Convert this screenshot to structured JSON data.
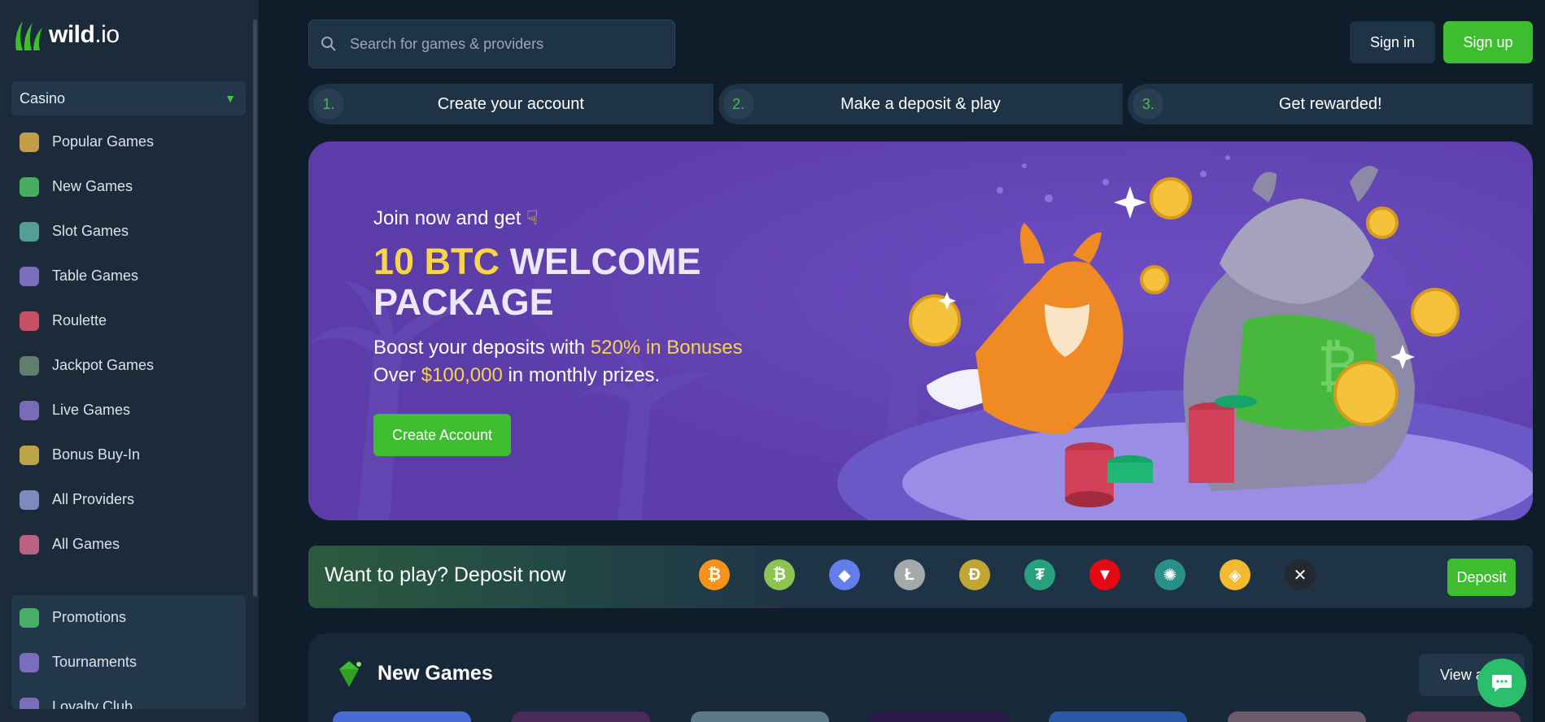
{
  "brand": {
    "name": "wild",
    "suffix": ".io"
  },
  "sidebar": {
    "category": "Casino",
    "items": [
      {
        "label": "Popular Games",
        "icon": "popular-games-icon",
        "color": "#e0b24a"
      },
      {
        "label": "New Games",
        "icon": "new-games-icon",
        "color": "#4fc36a"
      },
      {
        "label": "Slot Games",
        "icon": "slot-games-icon",
        "color": "#5fb3a4"
      },
      {
        "label": "Table Games",
        "icon": "table-games-icon",
        "color": "#8d7bd6"
      },
      {
        "label": "Roulette",
        "icon": "roulette-icon",
        "color": "#e5566c"
      },
      {
        "label": "Jackpot Games",
        "icon": "jackpot-icon",
        "color": "#6d8c74"
      },
      {
        "label": "Live Games",
        "icon": "live-games-icon",
        "color": "#8a77cf"
      },
      {
        "label": "Bonus Buy-In",
        "icon": "bonus-buy-icon",
        "color": "#d8b84a"
      },
      {
        "label": "All Providers",
        "icon": "providers-icon",
        "color": "#8f9bd6"
      },
      {
        "label": "All Games",
        "icon": "all-games-icon",
        "color": "#d66b8e"
      }
    ],
    "secondary": [
      {
        "label": "Promotions",
        "icon": "promotions-icon",
        "color": "#4fc36a"
      },
      {
        "label": "Tournaments",
        "icon": "trophy-icon",
        "color": "#8a77cf"
      },
      {
        "label": "Loyalty Club",
        "icon": "loyalty-icon",
        "color": "#8a77cf"
      }
    ]
  },
  "header": {
    "search_placeholder": "Search for games & providers",
    "signin": "Sign in",
    "signup": "Sign up"
  },
  "steps": [
    {
      "num": "1.",
      "label": "Create your account"
    },
    {
      "num": "2.",
      "label": "Make a deposit & play"
    },
    {
      "num": "3.",
      "label": "Get rewarded!"
    }
  ],
  "hero": {
    "join": "Join now and get",
    "title_gold": "10 BTC",
    "title_rest": "WELCOME",
    "title_line2": "PACKAGE",
    "sub1_pre": "Boost your deposits with",
    "sub1_gold": "520% in Bonuses",
    "sub2_pre": "Over",
    "sub2_gold": "$100,000",
    "sub2_post": "in monthly prizes.",
    "cta": "Create Account"
  },
  "deposit": {
    "text": "Want to play? Deposit now",
    "button": "Deposit",
    "coins": [
      {
        "name": "bitcoin-icon",
        "glyph": "₿",
        "color": "#f7931a"
      },
      {
        "name": "bitcoin-cash-icon",
        "glyph": "₿",
        "color": "#8dc351"
      },
      {
        "name": "ethereum-icon",
        "glyph": "◆",
        "color": "#627eea"
      },
      {
        "name": "litecoin-icon",
        "glyph": "Ł",
        "color": "#a6a9aa"
      },
      {
        "name": "dogecoin-icon",
        "glyph": "Ð",
        "color": "#c2a633"
      },
      {
        "name": "tether-icon",
        "glyph": "₮",
        "color": "#26a17b"
      },
      {
        "name": "tron-icon",
        "glyph": "▼",
        "color": "#e50915"
      },
      {
        "name": "cardano-icon",
        "glyph": "✺",
        "color": "#2a8f86"
      },
      {
        "name": "bnb-icon",
        "glyph": "◈",
        "color": "#f3ba2f"
      },
      {
        "name": "xrp-icon",
        "glyph": "✕",
        "color": "#23292f"
      }
    ]
  },
  "games": {
    "title": "New Games",
    "view_all": "View all"
  }
}
